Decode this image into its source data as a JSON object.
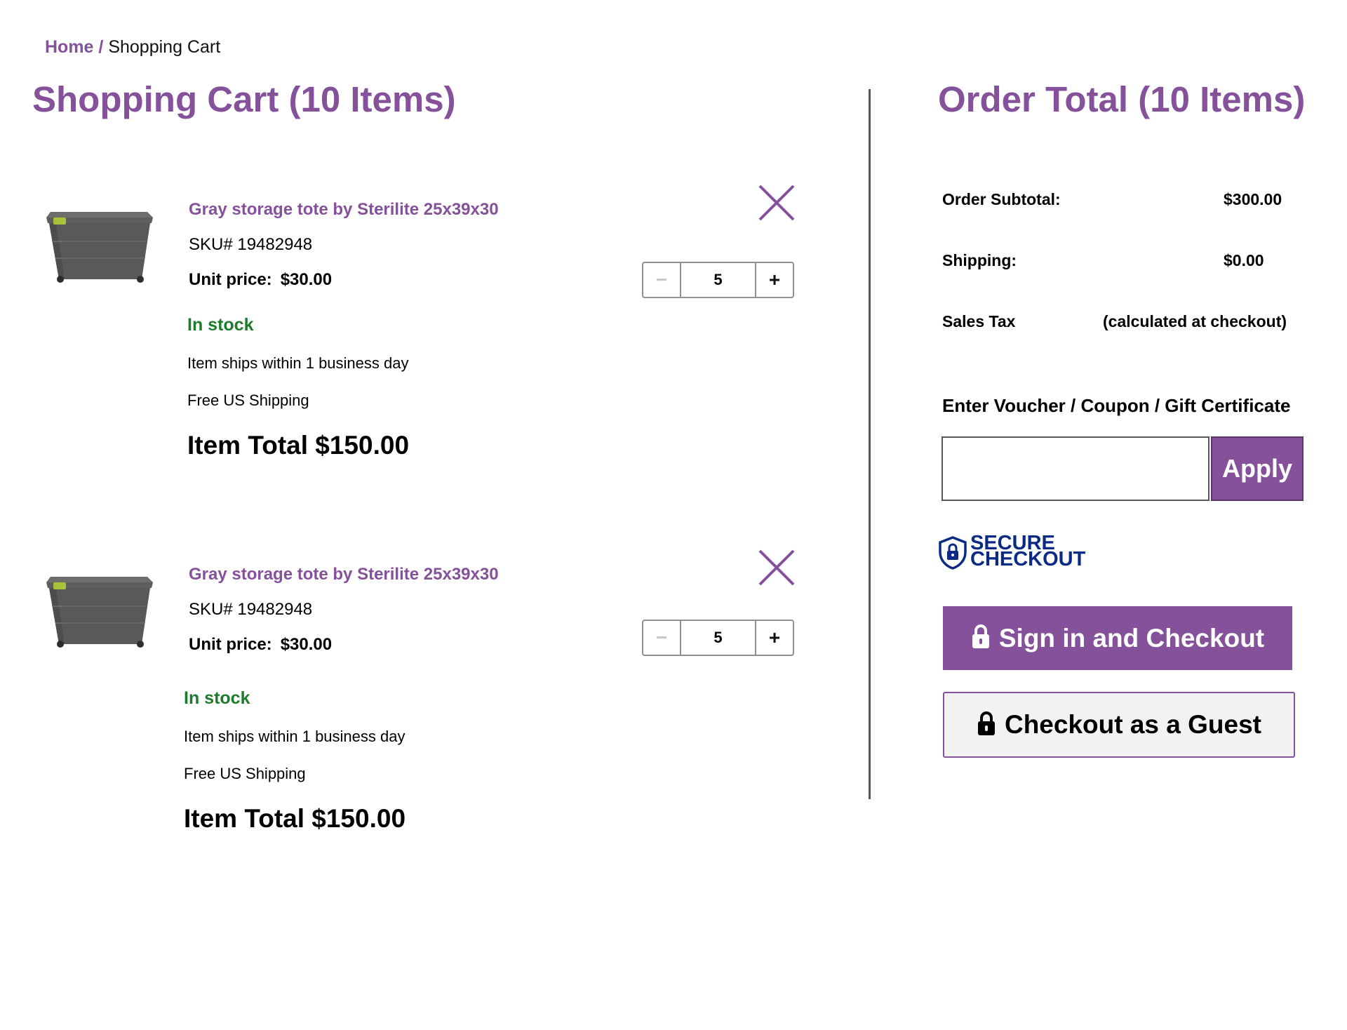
{
  "breadcrumb": {
    "home": "Home",
    "separator": "/",
    "current": "Shopping Cart"
  },
  "cart": {
    "title": "Shopping Cart (10 Items)",
    "items": [
      {
        "name": "Gray storage tote by Sterilite 25x39x30",
        "sku": "SKU# 19482948",
        "unit_price_label": "Unit price:",
        "unit_price": "$30.00",
        "stock": "In stock",
        "ships": "Item ships within 1 business day",
        "shipping": "Free US Shipping",
        "item_total": "Item Total $150.00",
        "quantity": "5",
        "minus_label": "−",
        "plus_label": "+",
        "remove_icon": "close-icon",
        "image_icon": "storage-tote-image"
      },
      {
        "name": "Gray storage tote by Sterilite 25x39x30",
        "sku": "SKU# 19482948",
        "unit_price_label": "Unit price:",
        "unit_price": "$30.00",
        "stock": "In stock",
        "ships": "Item ships within 1 business day",
        "shipping": "Free US Shipping",
        "item_total": "Item Total $150.00",
        "quantity": "5",
        "minus_label": "−",
        "plus_label": "+",
        "remove_icon": "close-icon",
        "image_icon": "storage-tote-image"
      }
    ]
  },
  "order": {
    "title": "Order Total (10 Items)",
    "subtotal_label": "Order Subtotal:",
    "subtotal_value": "$300.00",
    "shipping_label": "Shipping:",
    "shipping_value": "$0.00",
    "tax_label": "Sales Tax",
    "tax_value": "(calculated at checkout)",
    "voucher_label": "Enter Voucher / Coupon / Gift Certificate",
    "voucher_value": "",
    "apply_label": "Apply",
    "secure_line1": "SECURE",
    "secure_line2": "CHECKOUT",
    "sign_in_label": "Sign in and Checkout",
    "guest_label": "Checkout as a Guest",
    "lock_icon": "lock-icon"
  },
  "colors": {
    "accent": "#84519A",
    "in_stock": "#1E7B2E",
    "secure_badge": "#0A2A86"
  }
}
